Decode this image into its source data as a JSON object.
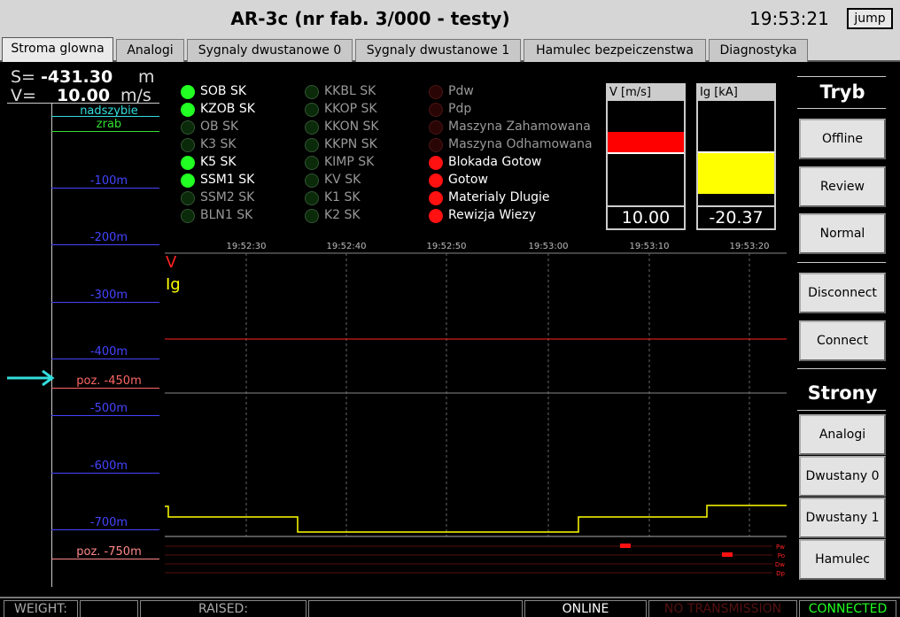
{
  "window": {
    "title": "AR-3c (nr fab. 3/000 - testy)",
    "clock": "19:53:21",
    "jump_label": "jump"
  },
  "tabs": [
    {
      "label": "Stroma glowna",
      "active": true
    },
    {
      "label": "Analogi",
      "active": false
    },
    {
      "label": "Sygnaly dwustanowe 0",
      "active": false
    },
    {
      "label": "Sygnaly dwustanowe 1",
      "active": false
    },
    {
      "label": "Hamulec bezpeiczenstwa",
      "active": false
    },
    {
      "label": "Diagnostyka",
      "active": false
    }
  ],
  "readouts": {
    "s": {
      "prefix": "S=",
      "value": "-431.30",
      "unit": "m"
    },
    "v": {
      "prefix": "V=",
      "value": "10.00",
      "unit": "m/s"
    }
  },
  "ruler": {
    "markers": [
      {
        "label": "nadszybie",
        "color": "#33dddd"
      },
      {
        "label": "zrab",
        "color": "#33dd33"
      },
      {
        "label": "-100m",
        "color": "#4444ff"
      },
      {
        "label": "-200m",
        "color": "#4444ff"
      },
      {
        "label": "-300m",
        "color": "#4444ff"
      },
      {
        "label": "-400m",
        "color": "#4444ff"
      },
      {
        "label": "poz. -450m",
        "color": "#ff6666"
      },
      {
        "label": "-500m",
        "color": "#4444ff"
      },
      {
        "label": "-600m",
        "color": "#4444ff"
      },
      {
        "label": "-700m",
        "color": "#4444ff"
      },
      {
        "label": "poz. -750m",
        "color": "#ff8888"
      }
    ],
    "pointer_color": "#33dddd"
  },
  "signals": {
    "col1": [
      {
        "label": "SOB SK",
        "on": true
      },
      {
        "label": "KZOB SK",
        "on": true
      },
      {
        "label": "OB SK",
        "on": false
      },
      {
        "label": "K3 SK",
        "on": false
      },
      {
        "label": "K5 SK",
        "on": true
      },
      {
        "label": "SSM1 SK",
        "on": true
      },
      {
        "label": "SSM2 SK",
        "on": false
      },
      {
        "label": "BLN1 SK",
        "on": false
      }
    ],
    "col2": [
      {
        "label": "KKBL SK",
        "on": false
      },
      {
        "label": "KKOP SK",
        "on": false
      },
      {
        "label": "KKON SK",
        "on": false
      },
      {
        "label": "KKPN SK",
        "on": false
      },
      {
        "label": "KIMP SK",
        "on": false
      },
      {
        "label": "KV SK",
        "on": false
      },
      {
        "label": "K1 SK",
        "on": false
      },
      {
        "label": "K2 SK",
        "on": false
      }
    ],
    "col3": [
      {
        "label": "Pdw",
        "on": false
      },
      {
        "label": "Pdp",
        "on": false
      },
      {
        "label": "Maszyna Zahamowana",
        "on": false
      },
      {
        "label": "Maszyna Odhamowana",
        "on": false
      },
      {
        "label": "Blokada Gotow",
        "on": true
      },
      {
        "label": "Gotow",
        "on": true
      },
      {
        "label": "Materialy Dlugie",
        "on": true
      },
      {
        "label": "Rewizja Wiezy",
        "on": true
      }
    ],
    "colors": {
      "green_on": "#22ff22",
      "green_off": "#0a2a0a",
      "red_on": "#ff1111",
      "red_off": "#2a0505"
    }
  },
  "meters": [
    {
      "label": "V [m/s]",
      "value": "10.00",
      "bar_color": "#ff0000",
      "fill_fraction_top": 0.3,
      "fill_fraction_bottom": 0.49
    },
    {
      "label": "Ig [kA]",
      "value": "-20.37",
      "bar_color": "#ffff00",
      "fill_fraction_top": 0.5,
      "fill_fraction_bottom": 0.89
    }
  ],
  "trend": {
    "time_ticks": [
      "19:52:30",
      "19:52:40",
      "19:52:50",
      "19:53:00",
      "19:53:10",
      "19:53:20"
    ],
    "series": [
      {
        "name": "V",
        "color": "#ff2222"
      },
      {
        "name": "Ig",
        "color": "#ffff00"
      }
    ],
    "digital_labels": [
      "Pw",
      "Po",
      "Dw",
      "Dp"
    ]
  },
  "right_panel": {
    "mode_title": "Tryb",
    "mode_buttons": [
      "Offline",
      "Review",
      "Normal"
    ],
    "conn_buttons": [
      "Disconnect",
      "Connect"
    ],
    "pages_title": "Strony",
    "page_buttons": [
      "Analogi",
      "Dwustany 0",
      "Dwustany 1",
      "Hamulec"
    ]
  },
  "status_bar": {
    "weight_label": "WEIGHT:",
    "raised_label": "RAISED:",
    "online": "ONLINE",
    "no_transmission": "NO TRANSMISSION",
    "connected": "CONNECTED",
    "colors": {
      "online": "#ffffff",
      "no_transmission": "#551111",
      "connected": "#22ff22",
      "label": "#aaaaaa"
    }
  }
}
